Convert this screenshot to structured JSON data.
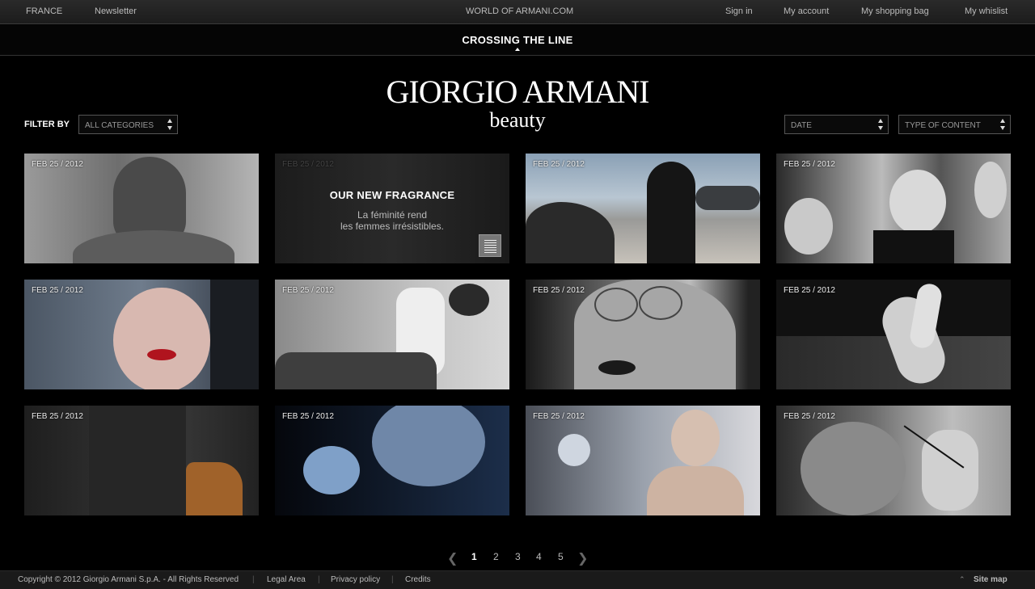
{
  "topbar": {
    "country": "FRANCE",
    "newsletter": "Newsletter",
    "site_title": "WORLD OF ARMANI.COM",
    "sign_in": "Sign in",
    "my_account": "My account",
    "shopping_bag": "My shopping bag",
    "wishlist": "My whislist"
  },
  "section": {
    "title": "CROSSING THE LINE"
  },
  "logo": {
    "main": "GIORGIO ARMANI",
    "sub": "beauty"
  },
  "filters": {
    "label": "FILTER BY",
    "category": "ALL CATEGORIES",
    "date": "DATE",
    "type": "TYPE OF CONTENT"
  },
  "tiles": [
    {
      "date": "FEB 25 / 2012"
    },
    {
      "date": "FEB 25 / 2012",
      "title": "OUR NEW FRAGRANCE",
      "text1": "La féminité rend",
      "text2": "les femmes irrésistibles."
    },
    {
      "date": "FEB 25 / 2012"
    },
    {
      "date": "FEB 25 / 2012"
    },
    {
      "date": "FEB 25 / 2012"
    },
    {
      "date": "FEB 25 / 2012"
    },
    {
      "date": "FEB 25 / 2012"
    },
    {
      "date": "FEB 25 / 2012"
    },
    {
      "date": "FEB 25 / 2012"
    },
    {
      "date": "FEB 25 / 2012"
    },
    {
      "date": "FEB 25 / 2012"
    },
    {
      "date": "FEB 25 / 2012"
    }
  ],
  "pagination": {
    "pages": [
      "1",
      "2",
      "3",
      "4",
      "5"
    ],
    "current": "1"
  },
  "footer": {
    "copyright": "Copyright © 2012 Giorgio Armani S.p.A. - All Rights Reserved",
    "legal": "Legal Area",
    "privacy": "Privacy policy",
    "credits": "Credits",
    "sitemap": "Site map"
  }
}
